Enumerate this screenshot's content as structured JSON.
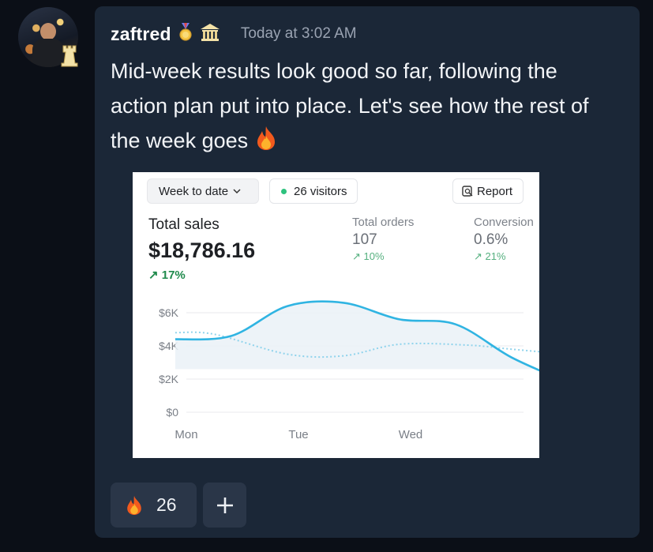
{
  "message": {
    "author": "zaftred",
    "timestamp": "Today at 3:02 AM",
    "text": "Mid-week results look good so far, following the action plan put into place. Let's see how the rest of the week goes",
    "badges": [
      "medal-icon",
      "bank-icon"
    ]
  },
  "attachment": {
    "filter_label": "Week to date",
    "visitors_label": "26 visitors",
    "report_label": "Report",
    "total_sales_label": "Total sales",
    "total_sales_value": "$18,786.16",
    "total_sales_change": "17%",
    "total_orders_label": "Total orders",
    "total_orders_value": "107",
    "total_orders_change": "10%",
    "conversion_label": "Conversion",
    "conversion_value": "0.6%",
    "conversion_change": "21%"
  },
  "chart_data": {
    "type": "line",
    "x_ticks": [
      "Mon",
      "Tue",
      "Wed"
    ],
    "y_ticks": [
      "$0",
      "$2K",
      "$4K",
      "$6K"
    ],
    "ylim": [
      0,
      6000
    ],
    "grid": true,
    "series": [
      {
        "style": "solid",
        "color": "#30b4e2",
        "points": [
          [
            0,
            4400
          ],
          [
            0.5,
            4600
          ],
          [
            1.0,
            6400
          ],
          [
            1.5,
            6600
          ],
          [
            2.0,
            5600
          ],
          [
            2.5,
            5300
          ],
          [
            3.0,
            3300
          ],
          [
            3.5,
            1800
          ]
        ]
      },
      {
        "style": "dotted",
        "color": "#30b4e2",
        "points": [
          [
            0,
            4800
          ],
          [
            0.35,
            4700
          ],
          [
            1.0,
            3500
          ],
          [
            1.5,
            3400
          ],
          [
            2.0,
            4100
          ],
          [
            2.6,
            4050
          ],
          [
            3.0,
            3800
          ],
          [
            3.5,
            3500
          ]
        ]
      }
    ]
  },
  "reactions": [
    {
      "emoji": "fire-icon",
      "count": "26"
    },
    {
      "emoji": "plus-icon",
      "label": "+"
    }
  ]
}
